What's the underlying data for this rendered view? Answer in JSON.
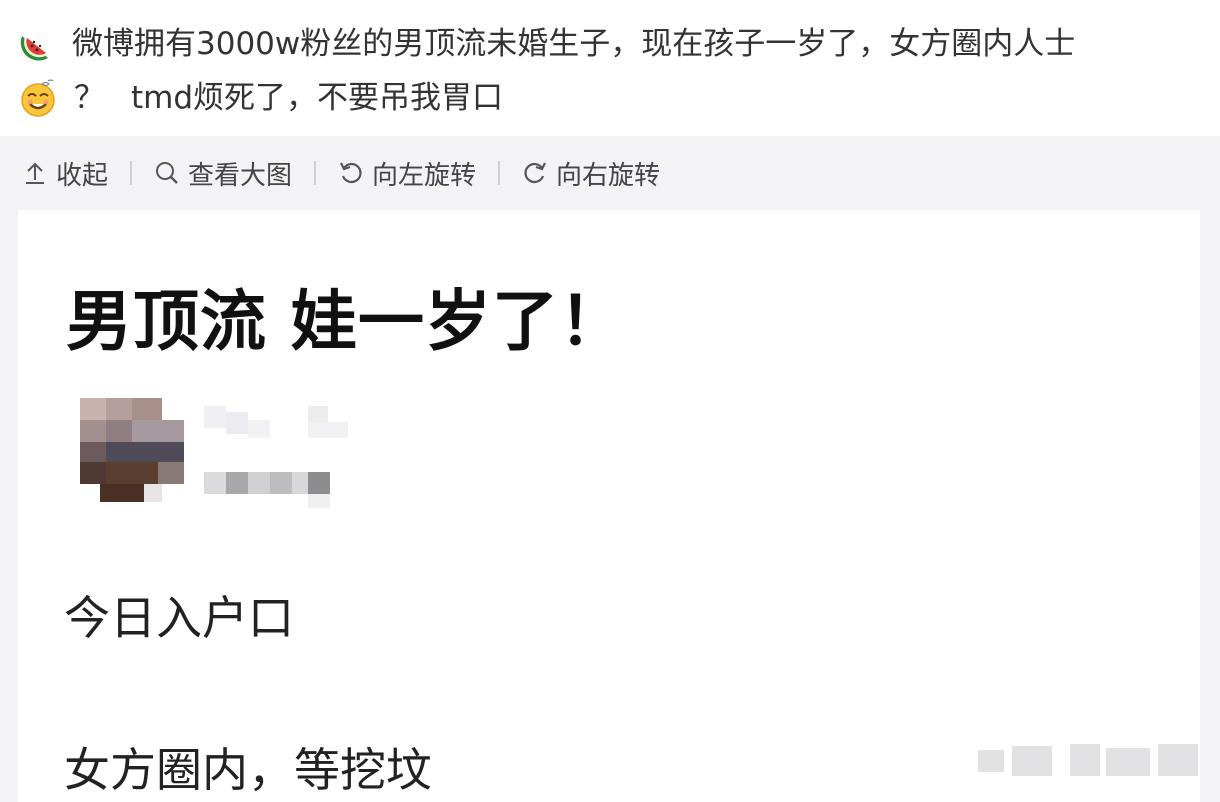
{
  "post": {
    "line1_text": "微博拥有3000w粉丝的男顶流未婚生子，现在孩子一岁了，女方圈内人士",
    "line2_q": "？",
    "line2_text": "tmd烦死了，不要吊我胃口",
    "emoji1": "watermelon-icon",
    "emoji2": "dizzy-smile-icon"
  },
  "toolbar": {
    "collapse_label": "收起",
    "view_large_label": "查看大图",
    "rotate_left_label": "向左旋转",
    "rotate_right_label": "向右旋转"
  },
  "card": {
    "title": "男顶流 娃一岁了！",
    "line1": "今日入户口",
    "line2": "女方圈内，等挖坟"
  },
  "colors": {
    "background": "#f3f3f5",
    "card": "#ffffff",
    "text": "#222222"
  }
}
